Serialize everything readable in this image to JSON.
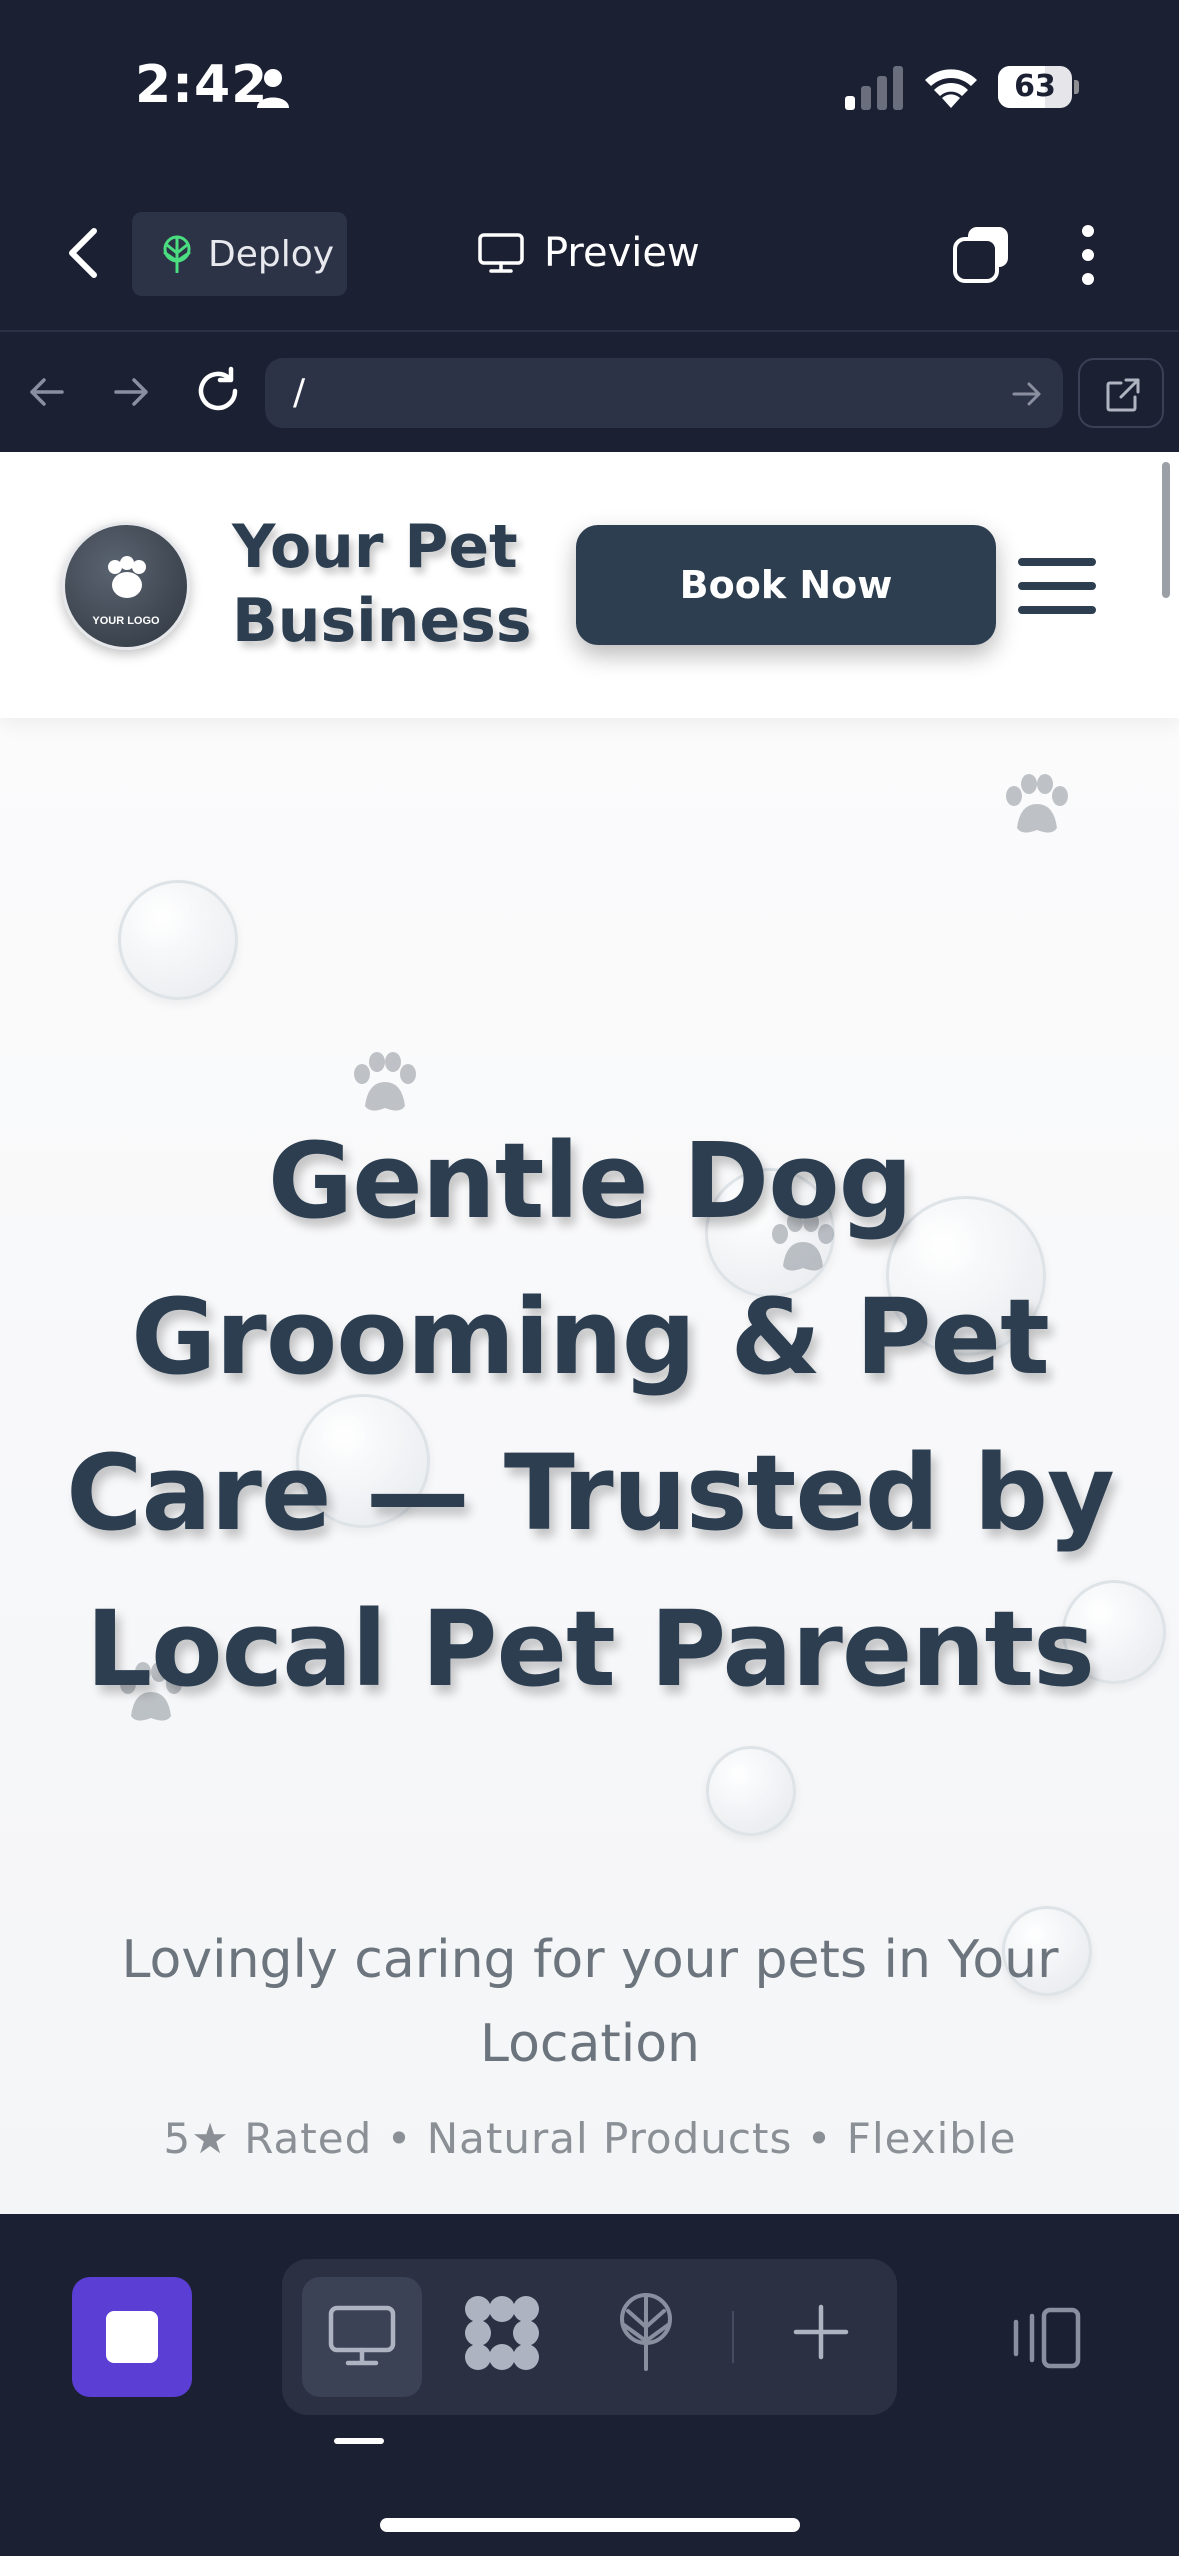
{
  "status_bar": {
    "time": "2:42",
    "battery_percent": "63"
  },
  "toolbar": {
    "deploy_label": "Deploy",
    "preview_label": "Preview"
  },
  "url_bar": {
    "url": "/"
  },
  "site": {
    "logo_text": "YOUR LOGO",
    "brand_name": "Your Pet Business",
    "book_button": "Book Now",
    "hero_title": "Gentle Dog Grooming & Pet Care — Trusted by Local Pet Parents",
    "hero_subtitle": "Lovingly caring for your pets in Your Location",
    "hero_features": "5★ Rated • Natural Products • Flexible"
  },
  "colors": {
    "app_background": "#1c2033",
    "accent_purple": "#5b3fd4",
    "brand_navy": "#2c3e50",
    "deploy_green": "#4ade80"
  },
  "icons": {
    "back": "chevron-left-icon",
    "deploy": "tree-icon",
    "preview": "monitor-icon",
    "tabs": "tabs-icon",
    "more": "more-vertical-icon",
    "reload": "reload-icon",
    "external": "external-link-icon",
    "components": "grid-blob-icon",
    "add": "plus-icon",
    "panel": "panel-toggle-icon"
  }
}
